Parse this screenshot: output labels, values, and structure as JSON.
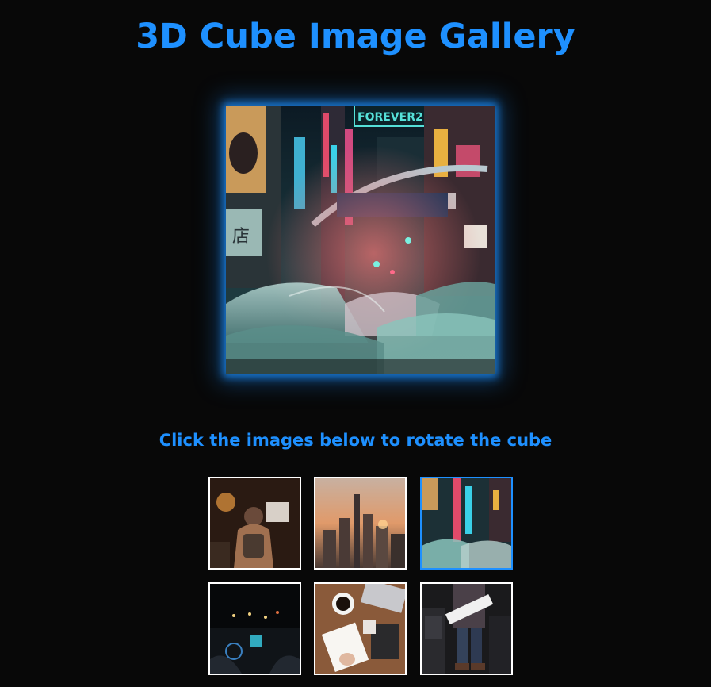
{
  "page": {
    "title": "3D Cube Image Gallery",
    "instruction": "Click the images below to rotate the cube"
  },
  "cube": {
    "current_face": "neon-street-umbrellas"
  },
  "thumbnails": [
    {
      "image": "city-night-traffic-backpack",
      "active": false
    },
    {
      "image": "city-skyline-sunset",
      "active": false
    },
    {
      "image": "neon-street-umbrellas",
      "active": true
    },
    {
      "image": "night-car-dashboard",
      "active": false
    },
    {
      "image": "desk-coffee-notebook",
      "active": false
    },
    {
      "image": "guitarist-sitting",
      "active": false
    }
  ],
  "colors": {
    "accent": "#1e90ff",
    "background": "#080808",
    "thumb_border": "#ffffff"
  }
}
